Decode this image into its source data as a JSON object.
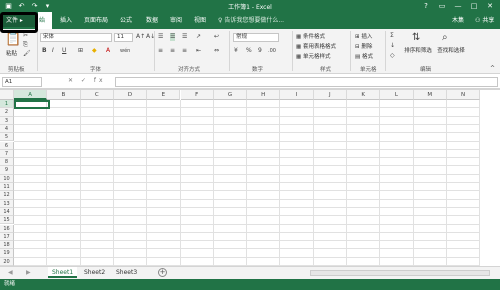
{
  "window": {
    "title": "工作簿1 - Excel",
    "qat": [
      "save-icon",
      "undo-icon",
      "redo-icon",
      "customize-icon"
    ],
    "controls": [
      "?",
      "▭",
      "—",
      "□",
      "✕"
    ]
  },
  "tabs": {
    "file": "文件",
    "home": "始",
    "insert": "插入",
    "layout": "页面布局",
    "formulas": "公式",
    "data": "数据",
    "review": "审阅",
    "view": "视图",
    "tell_me": "告诉我您想要做什么...",
    "user": "木集",
    "share": "共享"
  },
  "ribbon": {
    "paste": "粘贴",
    "font": {
      "name": "宋体",
      "size": "11",
      "grow": "A↑",
      "shrink": "A↓",
      "bold": "B",
      "italic": "I",
      "underline": "U",
      "wen": "wén"
    },
    "number": {
      "format": "常规",
      "percent": "%",
      "comma": "9"
    },
    "styles": {
      "conditional": "条件格式",
      "table": "套用表格格式",
      "cell": "单元格样式"
    },
    "cells": {
      "insert": "插入",
      "delete": "删除",
      "format": "格式"
    },
    "editing": {
      "sort": "排序和筛选",
      "find": "查找和选择"
    },
    "groups": {
      "clipboard": "剪贴板",
      "font": "字体",
      "align": "对齐方式",
      "number": "数字",
      "styles": "样式",
      "cells": "单元格",
      "editing": "编辑"
    }
  },
  "formula_bar": {
    "name_box": "A1",
    "fx": "✕ ✓ fx",
    "value": ""
  },
  "grid": {
    "columns": [
      "A",
      "B",
      "C",
      "D",
      "E",
      "F",
      "G",
      "H",
      "I",
      "J",
      "K",
      "L",
      "M",
      "N"
    ],
    "rows": [
      "1",
      "2",
      "3",
      "4",
      "5",
      "6",
      "7",
      "8",
      "9",
      "10",
      "11",
      "12",
      "13",
      "14",
      "15",
      "16",
      "17",
      "18",
      "19",
      "20"
    ]
  },
  "sheets": {
    "tabs": [
      "Sheet1",
      "Sheet2",
      "Sheet3"
    ],
    "active": "Sheet1",
    "add": "+"
  },
  "status": {
    "ready": "就绪"
  },
  "colors": {
    "accent": "#217346"
  }
}
